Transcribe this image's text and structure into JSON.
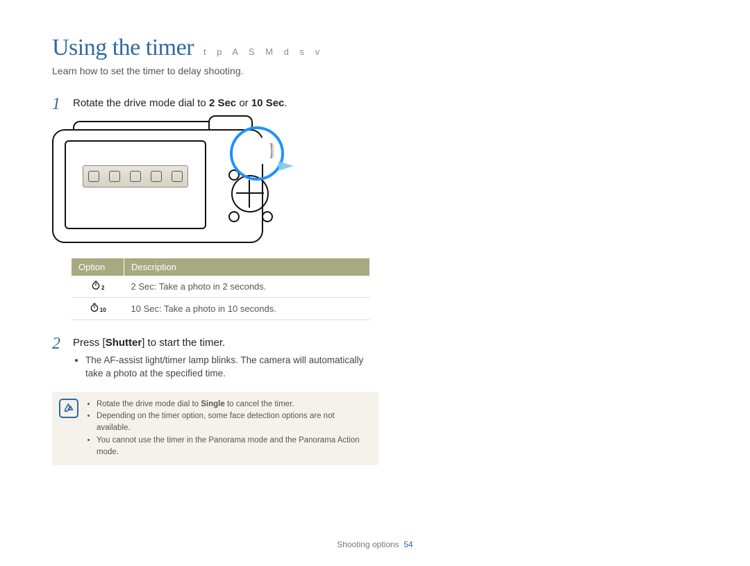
{
  "header": {
    "title": "Using the timer",
    "mode_icons": "t  p A S M d   s   v",
    "subtitle": "Learn how to set the timer to delay shooting."
  },
  "steps": {
    "s1_num": "1",
    "s1_prefix": "Rotate the drive mode dial to ",
    "s1_b1": "2 Sec",
    "s1_mid": " or ",
    "s1_b2": "10 Sec",
    "s1_suffix": ".",
    "s2_num": "2",
    "s2_prefix": "Press [",
    "s2_b": "Shutter",
    "s2_suffix": "] to start the timer.",
    "s2_bullet": "The AF-assist light/timer lamp blinks. The camera will automatically take a photo at the specified time."
  },
  "table": {
    "h_option": "Option",
    "h_desc": "Description",
    "r1_sub": "2",
    "r1_b": "2 Sec",
    "r1_rest": ": Take a photo in 2 seconds.",
    "r2_sub": "10",
    "r2_b": "10 Sec",
    "r2_rest": ": Take a photo in 10 seconds."
  },
  "note": {
    "b1a": "Rotate the drive mode dial to ",
    "b1b": "Single",
    "b1c": " to cancel the timer.",
    "b2": "Depending on the timer option, some face detection options are not available.",
    "b3": "You cannot use the timer in the Panorama mode and the Panorama Action mode."
  },
  "footer": {
    "section": "Shooting options",
    "page": "54"
  }
}
